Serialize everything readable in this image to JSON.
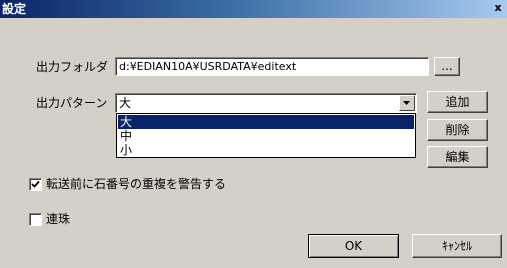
{
  "window": {
    "title": "設定",
    "close_label": "x"
  },
  "output_folder": {
    "label": "出力フォルダ",
    "value": "d:¥EDIAN10A¥USRDATA¥editext",
    "browse_label": "..."
  },
  "output_pattern": {
    "label": "出力パターン",
    "selected": "大",
    "options": [
      "大",
      "中",
      "小"
    ],
    "add_label": "追加",
    "delete_label": "削除",
    "edit_label": "編集"
  },
  "warn_duplicate": {
    "label": "転送前に石番号の重複を警告する",
    "checked": true
  },
  "renju": {
    "label": "連珠",
    "checked": false
  },
  "buttons": {
    "ok_label": "OK",
    "cancel_label": "ｷｬﾝｾﾙ"
  },
  "icons": {
    "dropdown": "chevron-down-icon",
    "check": "checkmark-icon",
    "close": "close-icon"
  },
  "colors": {
    "title_start": "#0a246a",
    "title_end": "#a6caf0",
    "selection": "#0a246a",
    "face": "#d4d0c8"
  }
}
